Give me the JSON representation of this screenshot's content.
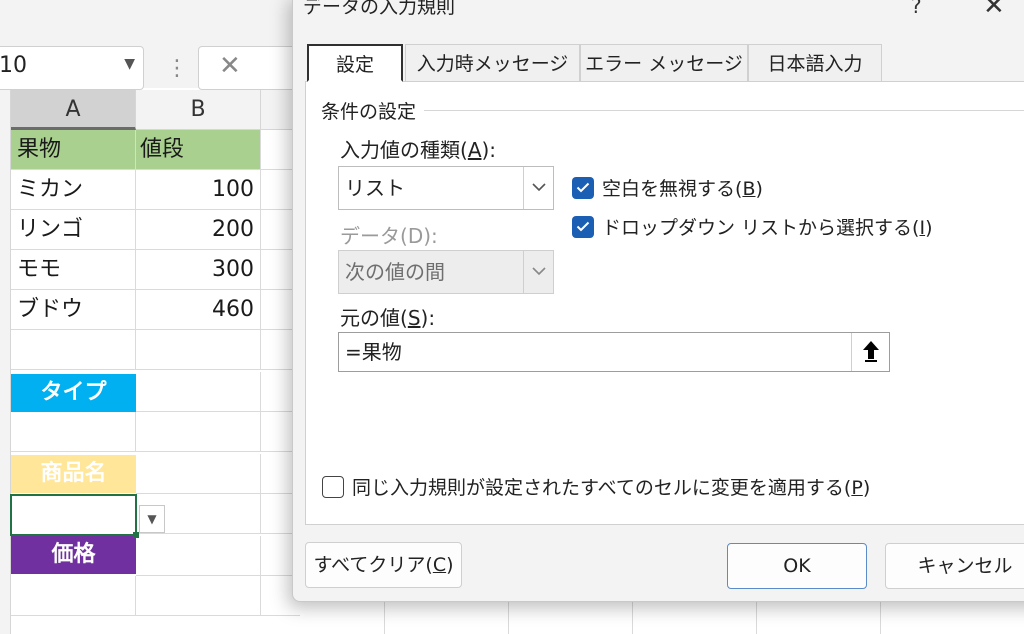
{
  "excel": {
    "name_box": "10",
    "columns": [
      "A",
      "B"
    ],
    "rows": [
      {
        "a": "果物",
        "b": "値段"
      },
      {
        "a": "ミカン",
        "b": "100"
      },
      {
        "a": "リンゴ",
        "b": "200"
      },
      {
        "a": "モモ",
        "b": "300"
      },
      {
        "a": "ブドウ",
        "b": "460"
      }
    ],
    "labels": {
      "type": "タイプ",
      "product": "商品名",
      "price": "価格"
    },
    "colors": {
      "header_green": "#a9d08e",
      "type_blue": "#00b0f0",
      "product_yellow": "#ffe699",
      "price_purple": "#7030a0"
    }
  },
  "dialog": {
    "title": "データの入力規則",
    "help": "?",
    "close": "✕",
    "tabs": [
      "設定",
      "入力時メッセージ",
      "エラー メッセージ",
      "日本語入力"
    ],
    "active_tab": "設定",
    "group_title": "条件の設定",
    "allow_label": "入力値の種類",
    "allow_key": "A",
    "allow_value": "リスト",
    "data_label": "データ",
    "data_key": "D",
    "data_value": "次の値の間",
    "ignore_blank": {
      "label": "空白を無視する",
      "key": "B",
      "checked": true
    },
    "in_cell_dropdown": {
      "label": "ドロップダウン リストから選択する",
      "key": "I",
      "checked": true
    },
    "source_label": "元の値",
    "source_key": "S",
    "source_value": "=果物",
    "apply_all": {
      "label": "同じ入力規則が設定されたすべてのセルに変更を適用する",
      "key": "P",
      "checked": false
    },
    "buttons": {
      "clear_label": "すべてクリア",
      "clear_key": "C",
      "ok": "OK",
      "cancel": "キャンセル"
    },
    "accent_color": "#1a5fb4"
  }
}
